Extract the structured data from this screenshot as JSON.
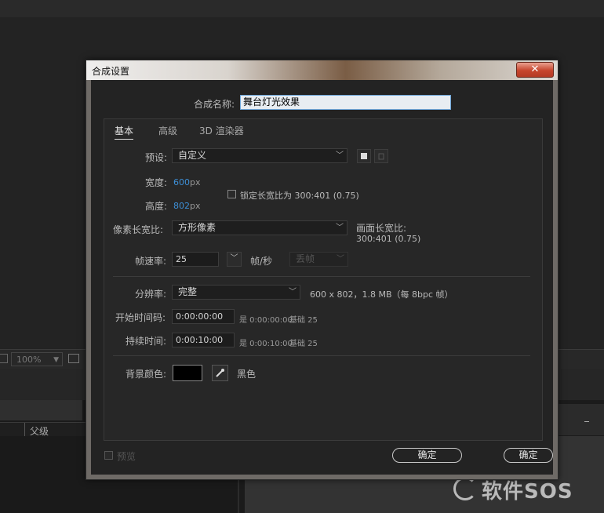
{
  "app_background": {
    "zoom_level": "100%",
    "column_header": "父级"
  },
  "watermark": {
    "text": "软件SOS"
  },
  "dialog": {
    "title": "合成设置",
    "close_glyph": "✕",
    "name": {
      "label": "合成名称:",
      "value": "舞台灯光效果"
    },
    "tabs": [
      {
        "label": "基本",
        "active": true
      },
      {
        "label": "高级",
        "active": false
      },
      {
        "label": "3D 渲染器",
        "active": false
      }
    ],
    "preset": {
      "label": "预设:",
      "value": "自定义"
    },
    "width": {
      "label": "宽度:",
      "value": "600",
      "unit": "px"
    },
    "height": {
      "label": "高度:",
      "value": "802",
      "unit": "px"
    },
    "lock_aspect": {
      "label": "锁定长宽比为 300:401 (0.75)",
      "checked": false
    },
    "pixel_aspect": {
      "label": "像素长宽比:",
      "value": "方形像素"
    },
    "frame_aspect": {
      "label": "画面长宽比:",
      "value": "300:401 (0.75)"
    },
    "frame_rate": {
      "label": "帧速率:",
      "value": "25",
      "unit": "帧/秒",
      "drop_frame": "丢帧"
    },
    "resolution": {
      "label": "分辨率:",
      "value": "完整",
      "info": "600 x 802，1.8 MB（每 8bpc 帧）"
    },
    "start_timecode": {
      "label": "开始时间码:",
      "value": "0:00:00:00",
      "note": "是 0:00:00:00",
      "base": "基础 25"
    },
    "duration": {
      "label": "持续时间:",
      "value": "0:00:10:00",
      "note": "是 0:00:10:00",
      "base": "基础 25"
    },
    "bg_color": {
      "label": "背景颜色:",
      "name": "黑色",
      "color": "#000000"
    },
    "preview": {
      "label": "预览",
      "checked": false
    },
    "ok_label": "确定",
    "cancel_label": "确定"
  }
}
